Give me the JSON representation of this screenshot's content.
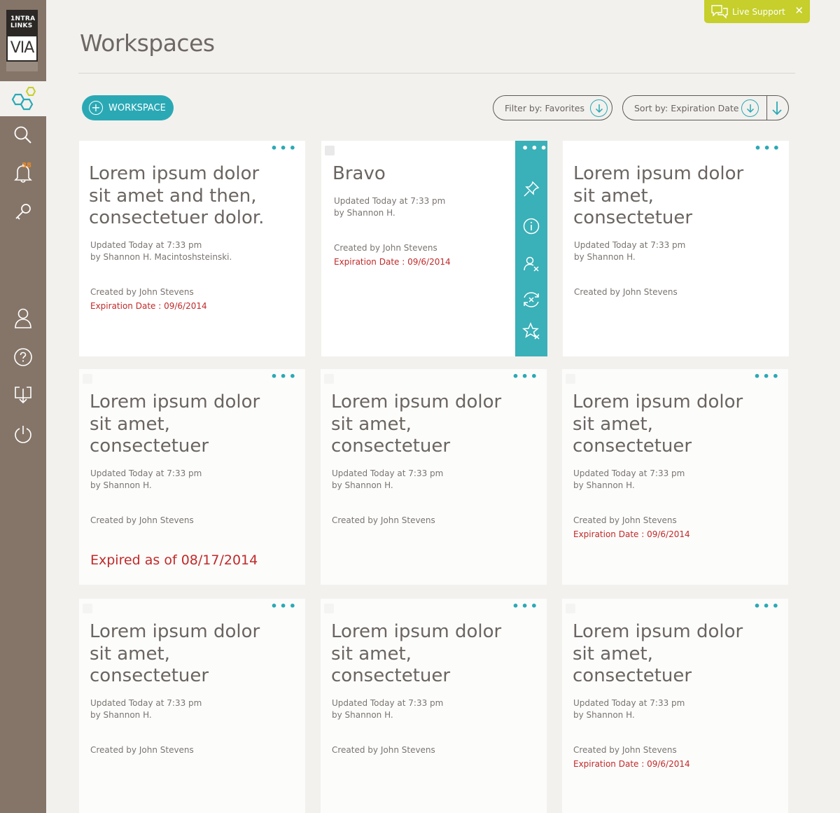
{
  "brand": {
    "logo_top_line1": "1NTRA",
    "logo_top_line2": "LINKS",
    "logo_via": "VIA"
  },
  "sidebar": {
    "items": [
      {
        "icon": "workspaces-hexagon-icon",
        "active": true
      },
      {
        "icon": "search-icon"
      },
      {
        "icon": "bell-icon",
        "badge": "38"
      },
      {
        "icon": "key-icon"
      },
      {
        "icon": "user-icon"
      },
      {
        "icon": "help-icon"
      },
      {
        "icon": "download-tray-icon"
      },
      {
        "icon": "power-icon"
      }
    ]
  },
  "live_support": {
    "label": "Live Support",
    "close": "✕"
  },
  "header": {
    "title": "Workspaces"
  },
  "toolbar": {
    "add_label": "WORKSPACE",
    "filter_label": "Filter by: Favorites",
    "sort_label": "Sort by: Expiration Date"
  },
  "colors": {
    "accent": "#2aa9b5",
    "sidebar": "#857568",
    "live_support": "#c6cf2b",
    "expiration": "#c02a2a"
  },
  "cards": [
    {
      "title": "Lorem ipsum dolor sit amet and then, consectetuer dolor.",
      "updated": "Updated Today at 7:33 pm",
      "by": "by Shannon H. Macintoshsteinski.",
      "created": "Created by John Stevens",
      "expiration": "Expiration Date : 09/6/2014"
    },
    {
      "title": "Bravo",
      "updated": "Updated Today at 7:33 pm",
      "by": "by Shannon H.",
      "created": "Created by John Stevens",
      "expiration": "Expiration Date : 09/6/2014",
      "actions": [
        "pin-icon",
        "info-icon",
        "remove-user-icon",
        "sync-off-icon",
        "unfavorite-star-icon"
      ]
    },
    {
      "title": "Lorem ipsum dolor sit amet, consectetuer",
      "updated": "Updated Today at 7:33 pm",
      "by": "by Shannon H.",
      "created": "Created by John Stevens"
    },
    {
      "title": "Lorem ipsum dolor sit amet, consectetuer",
      "updated": "Updated Today at 7:33 pm",
      "by": "by Shannon H.",
      "created": "Created by John Stevens",
      "expired": "Expired as of 08/17/2014"
    },
    {
      "title": "Lorem ipsum dolor sit amet, consectetuer",
      "updated": "Updated Today at 7:33 pm",
      "by": "by Shannon H.",
      "created": "Created by John Stevens"
    },
    {
      "title": "Lorem ipsum dolor sit amet, consectetuer",
      "updated": "Updated Today at 7:33 pm",
      "by": "by Shannon H.",
      "created": "Created by John Stevens",
      "expiration": "Expiration Date : 09/6/2014"
    },
    {
      "title": "Lorem ipsum dolor sit amet, consectetuer",
      "updated": "Updated Today at 7:33 pm",
      "by": "by Shannon H.",
      "created": "Created by John Stevens"
    },
    {
      "title": "Lorem ipsum dolor sit amet, consectetuer",
      "updated": "Updated Today at 7:33 pm",
      "by": "by Shannon H.",
      "created": "Created by John Stevens"
    },
    {
      "title": "Lorem ipsum dolor sit amet, consectetuer",
      "updated": "Updated Today at 7:33 pm",
      "by": "by Shannon H.",
      "created": "Created by John Stevens",
      "expiration": "Expiration Date : 09/6/2014"
    }
  ]
}
